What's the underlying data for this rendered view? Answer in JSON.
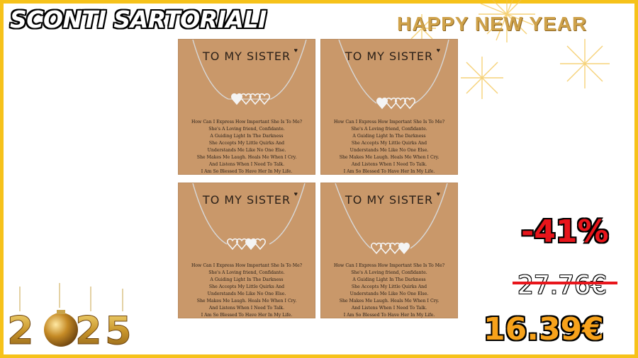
{
  "banner": {
    "title": "SCONTI SARTORIALI",
    "greeting": "HAPPY NEW YEAR"
  },
  "year_digits": [
    "2",
    "0",
    "2",
    "5"
  ],
  "product": {
    "cards": [
      {
        "title": "TO MY SISTER"
      },
      {
        "title": "TO MY SISTER"
      },
      {
        "title": "TO MY SISTER"
      },
      {
        "title": "TO MY SISTER"
      }
    ],
    "poem": [
      "How Can I Express How Important She Is To Me?",
      "She's A Loving friend, Confidante.",
      "A Guiding Light In The Darkness",
      "She Accepts My Little Quirks And",
      "Understands Me Like No One Else.",
      "She Makes Me Laugh. Heals Me When I Cry.",
      "And Listens When I Need To Talk.",
      "I Am So Blessed To Have Her In My Life."
    ]
  },
  "pricing": {
    "discount": "-41%",
    "old_price": "27.76€",
    "new_price": "16.39€"
  },
  "colors": {
    "border": "#f6c21a",
    "discount": "#e8151b",
    "new_price": "#f7a21b",
    "card": "#c9986a"
  }
}
